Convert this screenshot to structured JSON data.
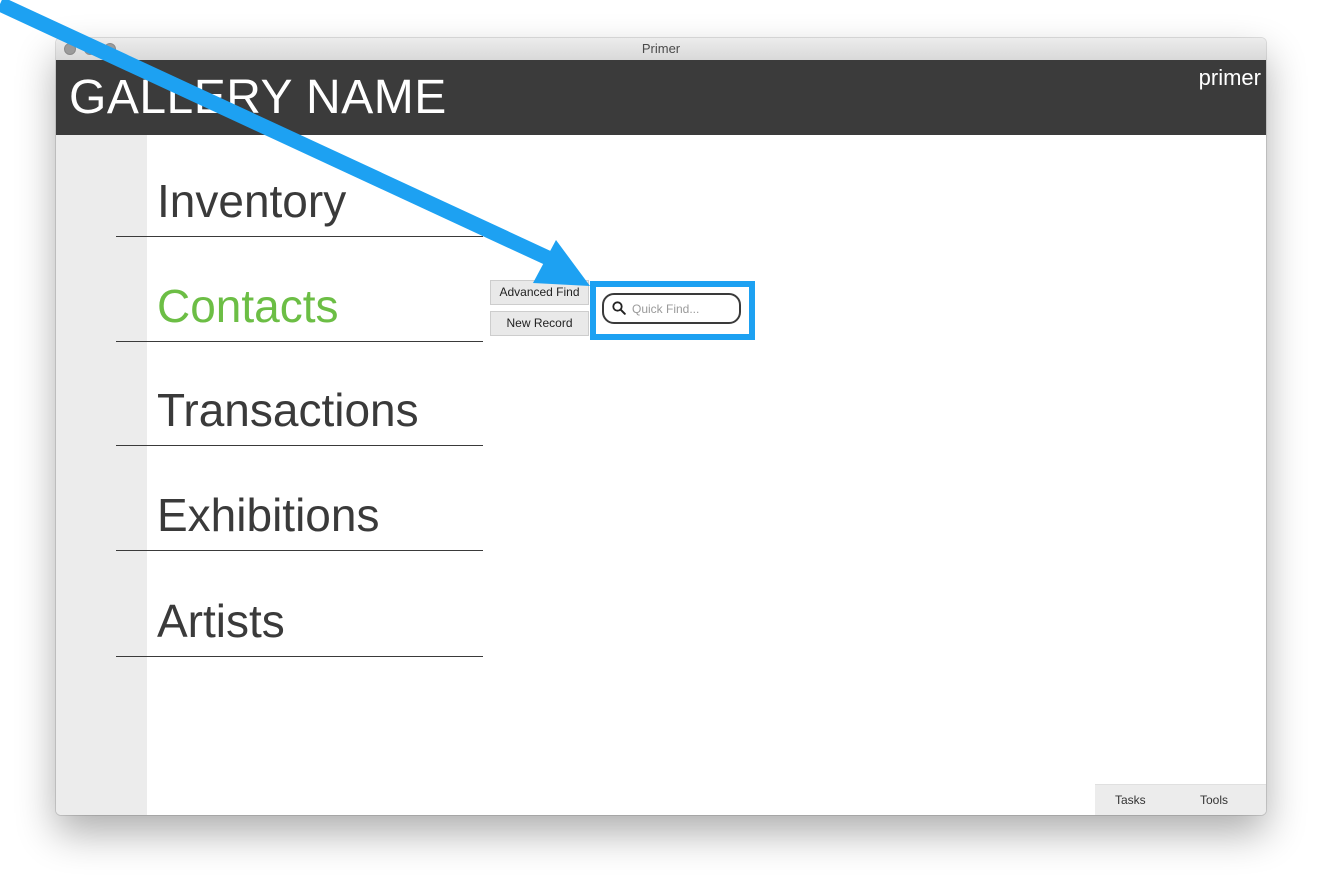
{
  "window": {
    "title": "Primer"
  },
  "header": {
    "gallery_name": "GALLERY NAME",
    "brand": "primer"
  },
  "nav": {
    "items": [
      {
        "label": "Inventory",
        "active": false
      },
      {
        "label": "Contacts",
        "active": true
      },
      {
        "label": "Transactions",
        "active": false
      },
      {
        "label": "Exhibitions",
        "active": false
      },
      {
        "label": "Artists",
        "active": false
      }
    ]
  },
  "actions": {
    "advanced_find": "Advanced Find",
    "new_record": "New Record"
  },
  "quick_find": {
    "placeholder": "Quick Find...",
    "value": ""
  },
  "bottom_bar": {
    "tasks": "Tasks",
    "tools": "Tools"
  },
  "annotation": {
    "arrow_color": "#1da1f2",
    "highlight_color": "#1da1f2"
  },
  "colors": {
    "header_bg": "#3b3b3b",
    "active_nav": "#6cbe45",
    "nav_text": "#3a3a3a"
  }
}
